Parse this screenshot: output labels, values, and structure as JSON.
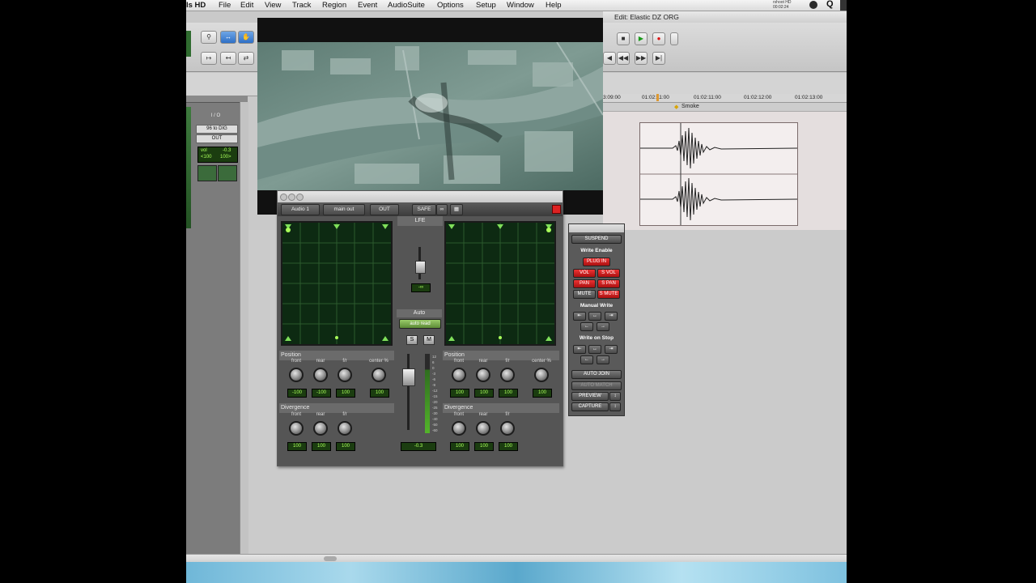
{
  "menubar": {
    "app_name": "ls HD",
    "items": [
      "File",
      "Edit",
      "View",
      "Track",
      "Region",
      "Event",
      "AudioSuite",
      "Options",
      "Setup",
      "Window",
      "Help"
    ],
    "status_line1": "rshoot HD",
    "status_line2": "00:02:24"
  },
  "edit_window": {
    "title": "Edit: Elastic DZ ORG",
    "timeline": [
      "3:09:00",
      "01:02:11:00",
      "01:02:11:00",
      "01:02:12:00",
      "01:02:13:00"
    ],
    "marker": "Smoke",
    "io_header": "I / O",
    "io_input": "96 to DIG",
    "io_output": "OUT",
    "vol_label": "vol",
    "vol_value": "-0.3",
    "pan_left": "<100",
    "pan_right": "100>"
  },
  "panner": {
    "track": "Audio 1",
    "output": "main out",
    "out_label": "OUT",
    "safe_label": "SAFE",
    "lfe_label": "LFE",
    "lfe_value": "-∞",
    "auto_label": "Auto",
    "auto_mode": "auto read",
    "solo": "S",
    "mute": "M",
    "fader_value": "-0.3",
    "left": {
      "position_label": "Position",
      "knob_labels": [
        "front",
        "rear",
        "f/r",
        "center %"
      ],
      "knob_values": [
        "-100",
        "-100",
        "100",
        "100"
      ],
      "divergence_label": "Divergence",
      "div_labels": [
        "front",
        "rear",
        "f/r"
      ],
      "div_values": [
        "100",
        "100",
        "100"
      ]
    },
    "right": {
      "position_label": "Position",
      "knob_labels": [
        "front",
        "rear",
        "f/r",
        "center %"
      ],
      "knob_values": [
        "100",
        "100",
        "100",
        "100"
      ],
      "divergence_label": "Divergence",
      "div_labels": [
        "front",
        "rear",
        "f/r"
      ],
      "div_values": [
        "100",
        "100",
        "100"
      ]
    },
    "meter_scale": [
      "12",
      "6",
      "0",
      "-3",
      "-6",
      "-9",
      "-12",
      "-15",
      "-20",
      "-25",
      "-30",
      "-40",
      "-50",
      "-60"
    ]
  },
  "automation": {
    "suspend": "SUSPEND",
    "write_enable": "Write Enable",
    "plugin": "PLUG IN",
    "vol": "VOL",
    "svol": "S VOL",
    "pan": "PAN",
    "span": "S PAN",
    "mute": "MUTE",
    "smute": "S MUTE",
    "manual_write": "Manual Write",
    "write_on_stop": "Write on Stop",
    "auto_join": "AUTO JOIN",
    "auto_match": "AUTO MATCH",
    "preview": "PREVIEW",
    "capture": "CAPTURE"
  }
}
